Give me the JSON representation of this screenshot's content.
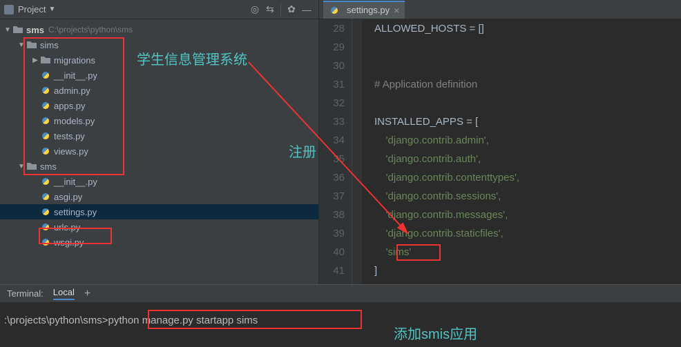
{
  "sidebar": {
    "title": "Project",
    "root": {
      "name": "sms",
      "path": "C:\\projects\\python\\sms"
    },
    "sims": {
      "name": "sims",
      "migrations": "migrations",
      "files": [
        "__init__.py",
        "admin.py",
        "apps.py",
        "models.py",
        "tests.py",
        "views.py"
      ]
    },
    "smspkg": {
      "name": "sms",
      "files": [
        "__init__.py",
        "asgi.py",
        "settings.py",
        "urls.py",
        "wsgi.py"
      ],
      "selected": "settings.py"
    }
  },
  "editor": {
    "tab": "settings.py",
    "lines": [
      {
        "n": "28",
        "t": "ALLOWED_HOSTS = []",
        "cls": ""
      },
      {
        "n": "29",
        "t": "",
        "cls": ""
      },
      {
        "n": "30",
        "t": "",
        "cls": ""
      },
      {
        "n": "31",
        "t": "# Application definition",
        "cls": "c-cm"
      },
      {
        "n": "32",
        "t": "",
        "cls": ""
      },
      {
        "n": "33",
        "t": "INSTALLED_APPS = [",
        "cls": ""
      },
      {
        "n": "34",
        "t": "    'django.contrib.admin',",
        "cls": "c-str"
      },
      {
        "n": "35",
        "t": "    'django.contrib.auth',",
        "cls": "c-str"
      },
      {
        "n": "36",
        "t": "    'django.contrib.contenttypes',",
        "cls": "c-str"
      },
      {
        "n": "37",
        "t": "    'django.contrib.sessions',",
        "cls": "c-str"
      },
      {
        "n": "38",
        "t": "    'django.contrib.messages',",
        "cls": "c-str"
      },
      {
        "n": "39",
        "t": "    'django.contrib.staticfiles',",
        "cls": "c-str"
      },
      {
        "n": "40",
        "t": "    'sims'",
        "cls": "c-str"
      },
      {
        "n": "41",
        "t": "]",
        "cls": ""
      }
    ]
  },
  "terminal": {
    "title": "Terminal:",
    "tab": "Local",
    "prompt": ":\\projects\\python\\sms>",
    "cmd": "python manage.py startapp sims"
  },
  "annotations": {
    "a1": "学生信息管理系统",
    "a2": "注册",
    "a3": "添加smis应用"
  }
}
